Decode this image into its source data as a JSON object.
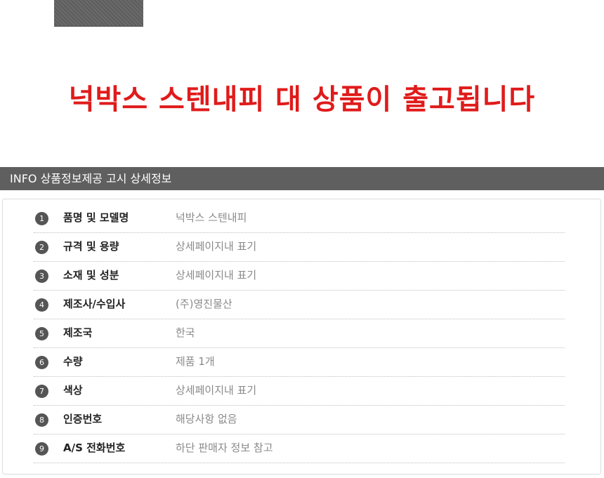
{
  "headline": "넉박스 스텐내피 대 상품이 출고됩니다",
  "info_bar": {
    "title": "INFO 상품정보제공 고시 상세정보"
  },
  "rows": [
    {
      "num": "1",
      "label": "품명 및 모델명",
      "value": "넉박스 스텐내피"
    },
    {
      "num": "2",
      "label": "규격 및 용량",
      "value": "상세페이지내 표기"
    },
    {
      "num": "3",
      "label": "소재 및 성분",
      "value": "상세페이지내 표기"
    },
    {
      "num": "4",
      "label": "제조사/수입사",
      "value": "(주)영진물산"
    },
    {
      "num": "5",
      "label": "제조국",
      "value": "한국"
    },
    {
      "num": "6",
      "label": "수량",
      "value": "제품 1개"
    },
    {
      "num": "7",
      "label": "색상",
      "value": "상세페이지내 표기"
    },
    {
      "num": "8",
      "label": "인증번호",
      "value": "해당사항 없음"
    },
    {
      "num": "9",
      "label": "A/S 전화번호",
      "value": "하단 판매자 정보 참고"
    }
  ],
  "colors": {
    "headline": "#e01b1b",
    "bar": "#5f5f5f",
    "badge": "#555555",
    "value_text": "#8a8a8a"
  }
}
